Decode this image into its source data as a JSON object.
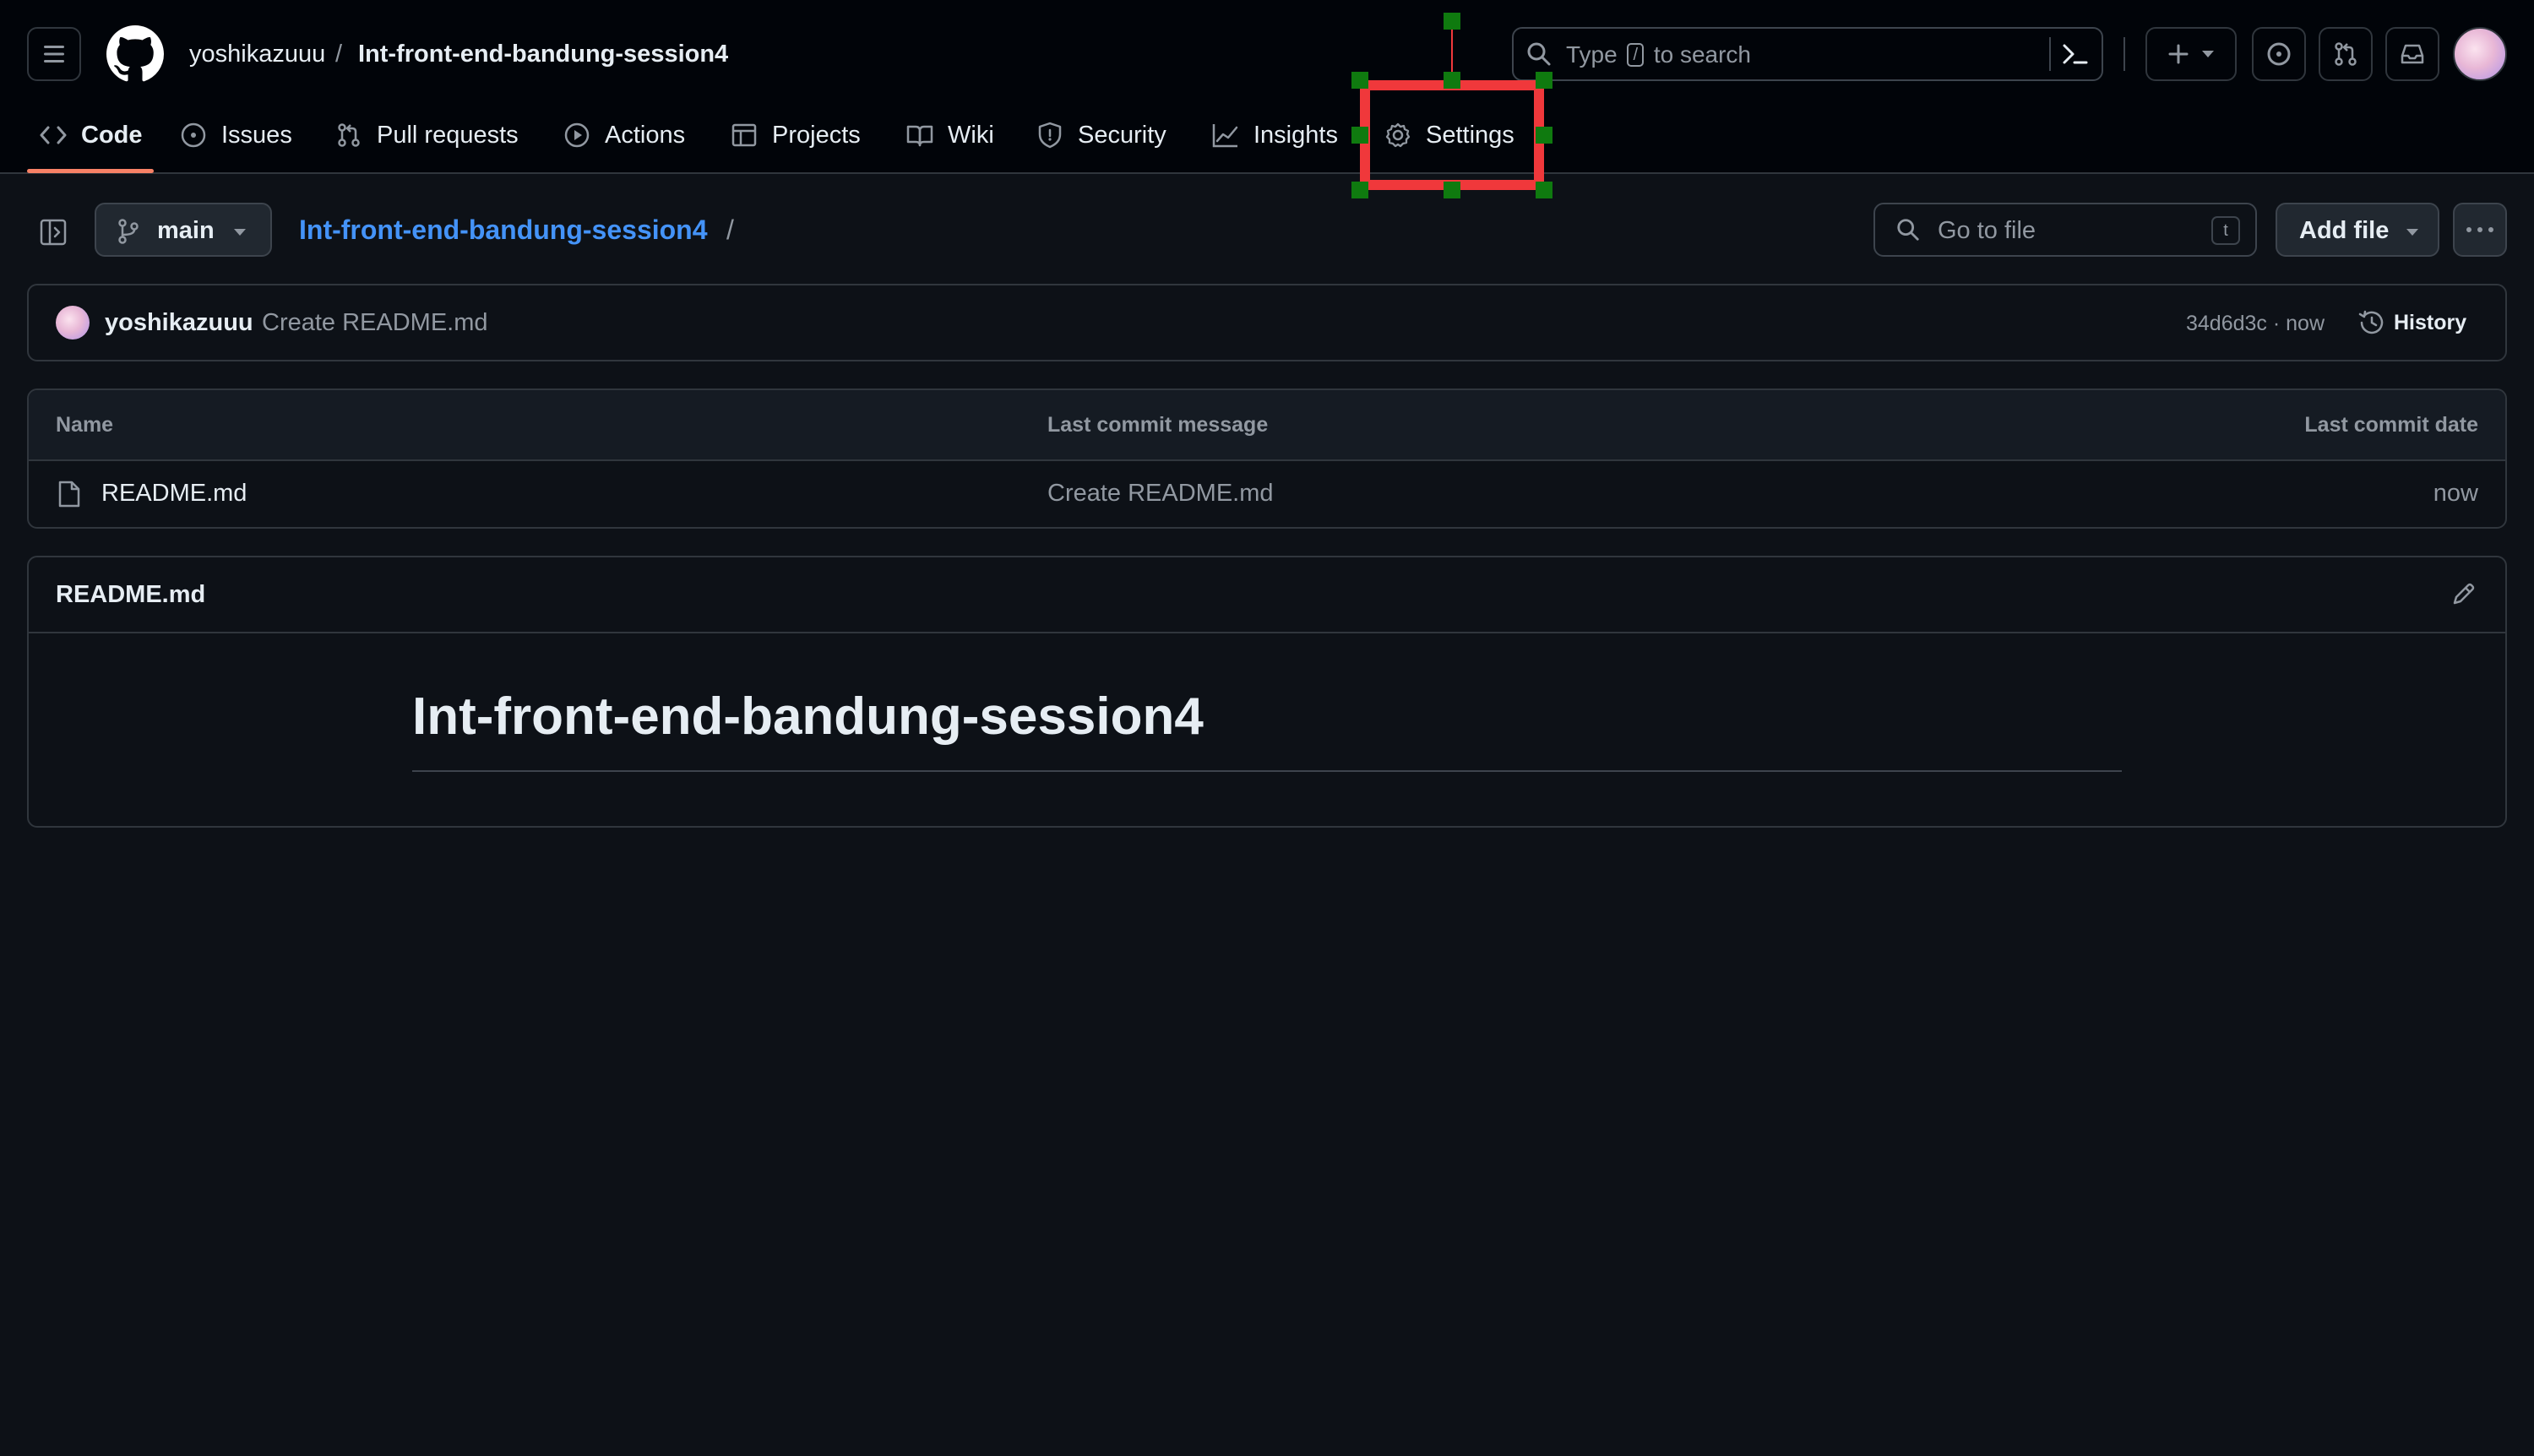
{
  "header": {
    "owner": "yoshikazuuu",
    "separator": "/",
    "repo": "Int-front-end-bandung-session4",
    "search": {
      "prefix": "Type",
      "key": "/",
      "suffix": "to search"
    }
  },
  "tabs": [
    {
      "label": "Code",
      "icon": "code-icon"
    },
    {
      "label": "Issues",
      "icon": "issue-icon"
    },
    {
      "label": "Pull requests",
      "icon": "pull-request-icon"
    },
    {
      "label": "Actions",
      "icon": "play-icon"
    },
    {
      "label": "Projects",
      "icon": "table-icon"
    },
    {
      "label": "Wiki",
      "icon": "book-icon"
    },
    {
      "label": "Security",
      "icon": "shield-icon"
    },
    {
      "label": "Insights",
      "icon": "graph-icon"
    },
    {
      "label": "Settings",
      "icon": "gear-icon"
    }
  ],
  "repo_bar": {
    "branch": "main",
    "breadcrumb_repo": "Int-front-end-bandung-session4",
    "breadcrumb_sep": "/",
    "go_to_file_placeholder": "Go to file",
    "go_to_file_key": "t",
    "add_file_label": "Add file"
  },
  "commit": {
    "author": "yoshikazuuu",
    "message": "Create README.md",
    "meta": "34d6d3c · now",
    "history_label": "History"
  },
  "files": {
    "columns": [
      "Name",
      "Last commit message",
      "Last commit date"
    ],
    "rows": [
      {
        "name": "README.md",
        "message": "Create README.md",
        "date": "now"
      }
    ]
  },
  "readme": {
    "filename": "README.md",
    "heading": "Int-front-end-bandung-session4"
  },
  "colors": {
    "accent_link": "#4493f8",
    "tab_underline": "#f78166",
    "highlight": "#f0383b",
    "handle": "#0f7a0f"
  }
}
